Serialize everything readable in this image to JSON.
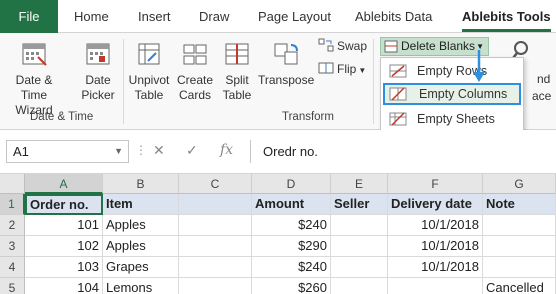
{
  "tabs": [
    "File",
    "Home",
    "Insert",
    "Draw",
    "Page Layout",
    "Ablebits Data",
    "Ablebits Tools"
  ],
  "ribbon": {
    "date_time": {
      "buttons": [
        {
          "line1": "Date &",
          "line2": "Time Wizard"
        },
        {
          "line1": "Date",
          "line2": "Picker"
        }
      ],
      "label": "Date & Time"
    },
    "transform": {
      "buttons": [
        {
          "line1": "Unpivot",
          "line2": "Table"
        },
        {
          "line1": "Create",
          "line2": "Cards"
        },
        {
          "line1": "Split",
          "line2": "Table"
        },
        {
          "line1": "Transpose",
          "line2": ""
        }
      ],
      "swap": "Swap",
      "flip": "Flip",
      "label": "Transform"
    },
    "delete_blanks": "Delete Blanks",
    "partial": {
      "nd": "nd",
      "ace": "ace"
    }
  },
  "menu": {
    "items": [
      {
        "label": "Empty Rows",
        "icon": "empty-rows-icon",
        "highlighted": false
      },
      {
        "label": "Empty Columns",
        "icon": "empty-columns-icon",
        "highlighted": true
      },
      {
        "label": "Empty Sheets",
        "icon": "empty-sheets-icon",
        "highlighted": false
      }
    ]
  },
  "formula_bar": {
    "name_box": "A1",
    "cancel": "✕",
    "enter": "✓",
    "fx": "fx",
    "value": "Oredr no."
  },
  "sheet": {
    "columns": [
      "A",
      "B",
      "C",
      "D",
      "E",
      "F",
      "G"
    ],
    "row_numbers": [
      "1",
      "2",
      "3",
      "4",
      "5"
    ],
    "rows": [
      [
        "Order no.",
        "Item",
        "",
        "Amount",
        "Seller",
        "Delivery date",
        "Note"
      ],
      [
        "101",
        "Apples",
        "",
        "$240",
        "",
        "10/1/2018",
        ""
      ],
      [
        "102",
        "Apples",
        "",
        "$290",
        "",
        "10/1/2018",
        ""
      ],
      [
        "103",
        "Grapes",
        "",
        "$240",
        "",
        "10/1/2018",
        ""
      ],
      [
        "104",
        "Lemons",
        "",
        "$260",
        "",
        "",
        "Cancelled"
      ]
    ]
  },
  "colors": {
    "excel_green": "#217346",
    "header_fill": "#dce3f0",
    "menu_highlight_border": "#2e8fe0",
    "delete_blanks_fill": "#c7e0cd"
  }
}
